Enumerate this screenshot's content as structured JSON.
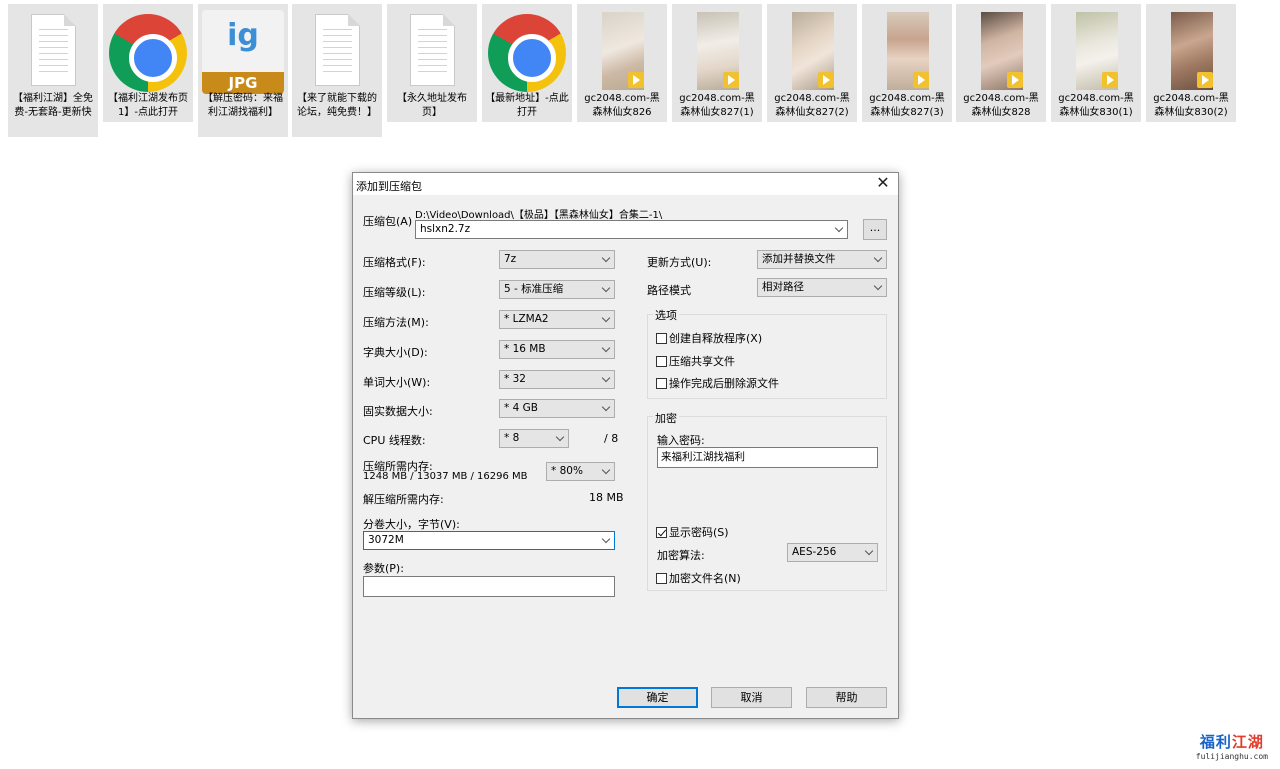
{
  "files": [
    {
      "type": "document",
      "icon": "document-icon",
      "name": "【福利江湖】全免费-无套路-更新快"
    },
    {
      "type": "chrome",
      "icon": "chrome-icon",
      "name": "【福利江湖发布页1】-点此打开"
    },
    {
      "type": "jpg",
      "icon": "jpg-file-icon",
      "badge": "JPG",
      "logo": "ig",
      "name": "【解压密码：来福利江湖找福利】"
    },
    {
      "type": "document",
      "icon": "document-icon",
      "name": "【来了就能下载的论坛，纯免费！】"
    },
    {
      "type": "document",
      "icon": "document-icon",
      "name": "【永久地址发布页】"
    },
    {
      "type": "chrome",
      "icon": "chrome-icon",
      "name": "【最新地址】-点此打开"
    },
    {
      "type": "video",
      "icon": "video-thumbnail-icon",
      "name": "gc2048.com-黑森林仙女826"
    },
    {
      "type": "video",
      "icon": "video-thumbnail-icon",
      "name": "gc2048.com-黑森林仙女827(1)"
    },
    {
      "type": "video",
      "icon": "video-thumbnail-icon",
      "name": "gc2048.com-黑森林仙女827(2)"
    },
    {
      "type": "video",
      "icon": "video-thumbnail-icon",
      "name": "gc2048.com-黑森林仙女827(3)"
    },
    {
      "type": "video",
      "icon": "video-thumbnail-icon",
      "name": "gc2048.com-黑森林仙女828"
    },
    {
      "type": "video",
      "icon": "video-thumbnail-icon",
      "name": "gc2048.com-黑森林仙女830(1)"
    },
    {
      "type": "video",
      "icon": "video-thumbnail-icon",
      "name": "gc2048.com-黑森林仙女830(2)"
    }
  ],
  "dialog": {
    "title": "添加到压缩包",
    "close_icon": "close-icon",
    "archive_label": "压缩包(A)",
    "archive_path": "D:\\Video\\Download\\【极品】【黑森林仙女】合集二-1\\",
    "archive_name": "hslxn2.7z",
    "browse_label": "...",
    "format_label": "压缩格式(F):",
    "format_value": "7z",
    "level_label": "压缩等级(L):",
    "level_value": "5 - 标准压缩",
    "method_label": "压缩方法(M):",
    "method_value": "* LZMA2",
    "dict_label": "字典大小(D):",
    "dict_value": "* 16 MB",
    "word_label": "单词大小(W):",
    "word_value": "* 32",
    "solid_label": "固实数据大小:",
    "solid_value": "* 4 GB",
    "cpu_label": "CPU 线程数:",
    "cpu_value": "* 8",
    "cpu_total": "/ 8",
    "mem_label": "压缩所需内存:",
    "mem_detail": "1248 MB / 13037 MB / 16296 MB",
    "mem_percent": "* 80%",
    "decomp_label": "解压缩所需内存:",
    "decomp_value": "18 MB",
    "split_label": "分卷大小，字节(V):",
    "split_value": "3072M",
    "params_label": "参数(P):",
    "params_value": "",
    "update_label": "更新方式(U):",
    "update_value": "添加并替换文件",
    "path_label": "路径模式",
    "path_value": "相对路径",
    "options_title": "选项",
    "opt_sfx": "创建自释放程序(X)",
    "opt_shared": "压缩共享文件",
    "opt_delete": "操作完成后删除源文件",
    "opt_sfx_checked": false,
    "opt_shared_checked": false,
    "opt_delete_checked": false,
    "enc_title": "加密",
    "pwd_label": "输入密码:",
    "pwd_value": "来福利江湖找福利",
    "show_pwd": "显示密码(S)",
    "show_pwd_checked": true,
    "enc_method_label": "加密算法:",
    "enc_method_value": "AES-256",
    "enc_names": "加密文件名(N)",
    "enc_names_checked": false,
    "ok_label": "确定",
    "cancel_label": "取消",
    "help_label": "帮助"
  },
  "watermark": {
    "cn_a": "福利",
    "cn_b": "江湖",
    "en": "fulijianghu.com"
  }
}
